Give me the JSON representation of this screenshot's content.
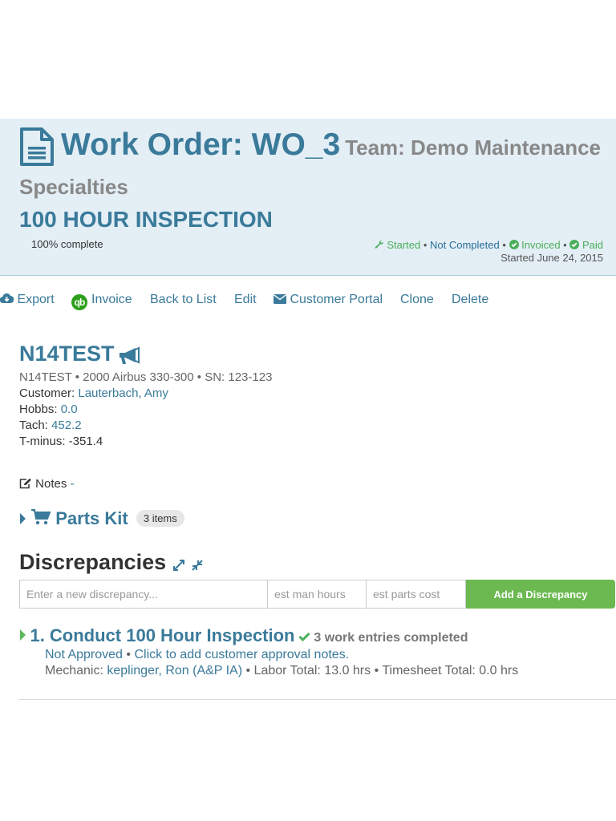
{
  "header": {
    "title": "Work Order: WO_3",
    "team_label": "Team: Demo Maintenance",
    "team_cont": "Specialties",
    "inspection": "100 HOUR INSPECTION",
    "progress_text": "100% complete",
    "progress_pct": 100,
    "status": {
      "started": "Started",
      "completed": "Not Completed",
      "invoiced": "Invoiced",
      "paid": "Paid",
      "sep": " • "
    },
    "started_date": "Started June 24, 2015",
    "colors": {
      "accent": "#3a7a9a",
      "success": "#4cae5a",
      "panel": "#e3eef5"
    }
  },
  "toolbar": {
    "export": "Export",
    "invoice": "Invoice",
    "qb_logo": "qb",
    "back": "Back to List",
    "edit": "Edit",
    "portal": "Customer Portal",
    "clone": "Clone",
    "delete": "Delete"
  },
  "aircraft": {
    "tail": "N14TEST",
    "summary": "N14TEST • 2000 Airbus 330-300 • SN: 123-123",
    "customer_label": "Customer: ",
    "customer": "Lauterbach, Amy",
    "hobbs_label": "Hobbs: ",
    "hobbs": "0.0",
    "tach_label": "Tach: ",
    "tach": "452.2",
    "tminus": "T-minus: -351.4"
  },
  "notes": {
    "label": "Notes",
    "value": "-"
  },
  "parts_kit": {
    "label": "Parts Kit",
    "badge": "3 items"
  },
  "discrepancies": {
    "title": "Discrepancies",
    "input_placeholder": "Enter a new discrepancy...",
    "hours_placeholder": "est man hours",
    "cost_placeholder": "est parts cost",
    "add_button": "Add a Discrepancy",
    "items": [
      {
        "name": "1. Conduct 100 Hour Inspection",
        "work_entries": "3 work entries completed",
        "approval": "Not Approved",
        "approval_note": "Click to add customer approval notes.",
        "mechanic_label": "Mechanic: ",
        "mechanic": "keplinger, Ron (A&P IA)",
        "labor": " • Labor Total: 13.0 hrs • Timesheet Total: 0.0 hrs"
      }
    ]
  }
}
